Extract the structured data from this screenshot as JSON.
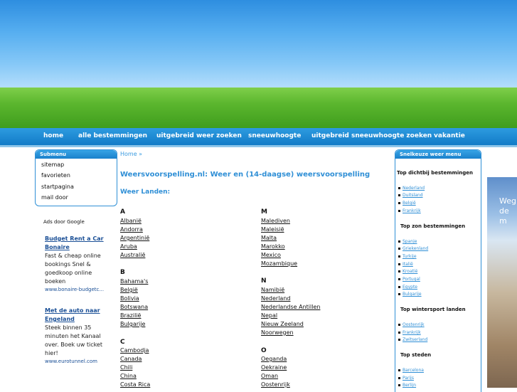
{
  "nav": [
    "home",
    "alle bestemmingen",
    "uitgebreid weer zoeken",
    "sneeuwhoogte",
    "uitgebreid sneeuwhoogte zoeken",
    "vakantie"
  ],
  "submenu": {
    "title": "Submenu",
    "items": [
      "sitemap",
      "favorieten",
      "startpagina",
      "mail door"
    ]
  },
  "ads": {
    "label": "Ads door Google",
    "items": [
      {
        "title": "Budget Rent a Car Bonaire",
        "text": "Fast & cheap online bookings Snel & goedkoop online boeken",
        "url": "www.bonaire-budgetc..."
      },
      {
        "title": "Met de auto naar Engeland",
        "text": "Steek binnen 35 minuten het Kanaal over. Boek uw ticket hier!",
        "url": "www.eurotunnel.com"
      }
    ]
  },
  "breadcrumb": "Home »",
  "page_title": "Weersvoorspelling.nl: Weer en (14-daagse) weersvoorspelling",
  "section_title": "Weer Landen:",
  "countries_left": [
    {
      "letter": "A",
      "items": [
        "Albanië",
        "Andorra",
        "Argentinië",
        "Aruba",
        "Australië"
      ]
    },
    {
      "letter": "B",
      "items": [
        "Bahama's",
        "België",
        "Bolivia",
        "Botswana",
        "Brazilië",
        "Bulgarije"
      ]
    },
    {
      "letter": "C",
      "items": [
        "Cambodja",
        "Canada",
        "Chili",
        "China",
        "Costa Rica"
      ]
    }
  ],
  "countries_right": [
    {
      "letter": "M",
      "items": [
        "Malediven",
        "Maleisië",
        "Malta",
        "Marokko",
        "Mexico",
        "Mozambique"
      ]
    },
    {
      "letter": "N",
      "items": [
        "Namibië",
        "Nederland",
        "Nederlandse Antillen",
        "Nepal",
        "Nieuw Zeeland",
        "Noorwegen"
      ]
    },
    {
      "letter": "O",
      "items": [
        "Oeganda",
        "Oekraine",
        "Oman",
        "Oostenrijk"
      ]
    }
  ],
  "quick": {
    "title": "Snelkeuze weer menu",
    "groups": [
      {
        "title": "Top dichtbij bestemmingen",
        "items": [
          "Nederland",
          "Duitsland",
          "België",
          "Frankrijk"
        ]
      },
      {
        "title": "Top zon bestemmingen",
        "items": [
          "Spanje",
          "Griekenland",
          "Turkije",
          "Italië",
          "Kroatië",
          "Portugal",
          "Egypte",
          "Bulgarije"
        ]
      },
      {
        "title": "Top wintersport landen",
        "items": [
          "Oostenrijk",
          "Frankrijk",
          "Zwitserland"
        ]
      },
      {
        "title": "Top steden",
        "items": [
          "Barcelona",
          "Parijs",
          "Berlijn"
        ]
      }
    ]
  },
  "photo_text": "Weg de m",
  "colors": {
    "nav": "#1a84cc",
    "accent": "#2f8fd6",
    "link_blue": "#1a4f96"
  }
}
